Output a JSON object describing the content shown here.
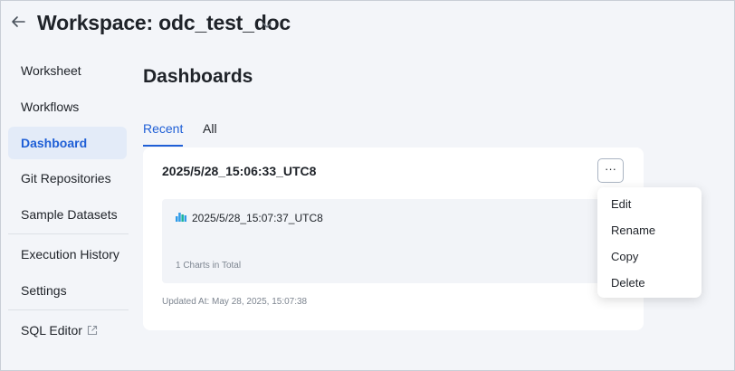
{
  "header": {
    "title": "Workspace: odc_test_doc"
  },
  "sidebar": {
    "items": [
      {
        "label": "Worksheet"
      },
      {
        "label": "Workflows"
      },
      {
        "label": "Dashboard",
        "active": true
      },
      {
        "label": "Git Repositories"
      },
      {
        "label": "Sample Datasets"
      },
      {
        "label": "Execution History"
      },
      {
        "label": "Settings"
      },
      {
        "label": "SQL Editor",
        "external": true
      }
    ]
  },
  "main": {
    "title": "Dashboards",
    "tabs": [
      {
        "label": "Recent",
        "active": true
      },
      {
        "label": "All",
        "active": false
      }
    ],
    "card": {
      "title": "2025/5/28_15:06:33_UTC8",
      "more_label": "···",
      "chart_name": "2025/5/28_15:07:37_UTC8",
      "chart_count": "1 Charts in Total",
      "updated_at": "Updated At: May 28, 2025, 15:07:38"
    },
    "menu": {
      "items": [
        "Edit",
        "Rename",
        "Copy",
        "Delete"
      ]
    }
  },
  "colors": {
    "accent": "#1f5fd6",
    "active_bg": "#e3ebf8",
    "page_bg": "#f3f5f9",
    "chart_icon": "#2f9be8"
  },
  "icons": [
    "back-arrow-icon",
    "chevron-down-icon",
    "external-link-icon",
    "bar-chart-icon"
  ]
}
